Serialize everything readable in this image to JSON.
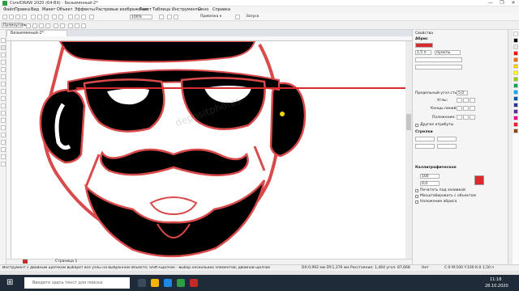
{
  "window": {
    "title": "CorelDRAW 2020 (64-Bit) - Безымянный-2*",
    "controls": [
      "—",
      "❐",
      "✕"
    ]
  },
  "menu": [
    "Файл",
    "Правка",
    "Вид",
    "Макет",
    "Объект",
    "Эффекты",
    "Растровые изображения",
    "Текст",
    "Таблица",
    "Инструменты",
    "Окно",
    "Справка"
  ],
  "toolbar": {
    "zoom": "100%",
    "snap": "Привязка к",
    "launch": "Запуск"
  },
  "propbar": {
    "mode": "Прямоуголь..."
  },
  "document": {
    "tab": "Безымянный-2*",
    "page_label": "Страница 1",
    "watermark": "depositphotos"
  },
  "panel": {
    "title": "Свойства",
    "section_outline": "Абрис",
    "width_value": "1,5 п",
    "units": "пункты",
    "miter_label": "Предельный угол стыка:",
    "miter_value": "5,0",
    "corners_label": "Углы:",
    "line_ends_label": "Концы линий:",
    "position_label": "Положение:",
    "other_attr": "Другие атрибуты",
    "arrows_title": "Стрелки",
    "calligraphic_title": "Каллиграфическое",
    "stretch_value": "100",
    "angle_value": "0,0",
    "print_under": "Печатать под заливкой",
    "scale_with_object": "Масштабировать с объектом",
    "overprint": "Наложение абриса",
    "accent_color": "#d92b2b"
  },
  "status": {
    "hint": "Инструмент с двойным щелчком выберет все узлы на выбранном объекте; Shift+щелчок - выбор нескольких элементов; двойной щелчок кривой - добавление узла; двойной щелчок узла - его удаление",
    "coords": "DX:0,992 мм DY:1,376 мм Расстояние: 1,464 угол: 87,668",
    "fill_info": "Нет",
    "outline_info": "C:0 M:100 Y:100 K:0 1,50 п"
  },
  "taskbar": {
    "search_placeholder": "Введите здесь текст для поиска",
    "time": "11:18",
    "date": "28.10.2020"
  },
  "palette": [
    "#ffffff",
    "#000000",
    "#e6e6e6",
    "#ff0000",
    "#ff6600",
    "#ffcc00",
    "#ffff00",
    "#99cc00",
    "#00a651",
    "#00aeef",
    "#0054a6",
    "#2e3192",
    "#662d91",
    "#ec008c",
    "#ed1c24",
    "#8b4513"
  ]
}
